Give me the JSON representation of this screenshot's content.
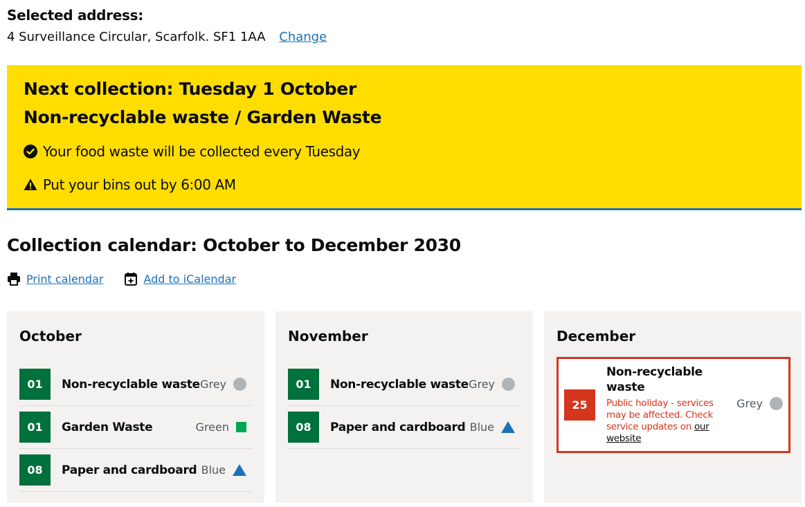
{
  "address": {
    "label": "Selected address:",
    "value": "4 Surveillance Circular, Scarfolk. SF1 1AA",
    "change_link": "Change"
  },
  "banner": {
    "next_collection": "Next collection: Tuesday 1 October",
    "types": "Non-recyclable waste / Garden Waste",
    "food_notice": "Your food waste will be collected every Tuesday",
    "bins_notice": "Put your bins out by 6:00 AM",
    "bg_color": "#ffdd00"
  },
  "calendar": {
    "title": "Collection calendar: October to December 2030",
    "print_label": "Print calendar",
    "ical_label": "Add to iCalendar",
    "months": [
      {
        "name": "October",
        "rows": [
          {
            "day": "01",
            "type": "Non-recyclable waste",
            "bin": "Grey",
            "shape": "circle"
          },
          {
            "day": "01",
            "type": "Garden Waste",
            "bin": "Green",
            "shape": "square"
          },
          {
            "day": "08",
            "type": "Paper and cardboard",
            "bin": "Blue",
            "shape": "triangle"
          }
        ]
      },
      {
        "name": "November",
        "rows": [
          {
            "day": "01",
            "type": "Non-recyclable waste",
            "bin": "Grey",
            "shape": "circle"
          },
          {
            "day": "08",
            "type": "Paper and cardboard",
            "bin": "Blue",
            "shape": "triangle"
          }
        ]
      },
      {
        "name": "December",
        "holiday_row": {
          "day": "25",
          "type": "Non-recyclable waste",
          "warning": "Public holiday - services may be affected. Check service updates on",
          "link": "our website",
          "bin": "Grey",
          "shape": "circle"
        }
      }
    ]
  },
  "colors": {
    "link": "#1d70b8",
    "day_green": "#00703c",
    "holiday_red": "#d4351c",
    "grey_bin": "#b1b4b6",
    "green_bin": "#00a651",
    "blue_bin": "#1d70b8"
  }
}
